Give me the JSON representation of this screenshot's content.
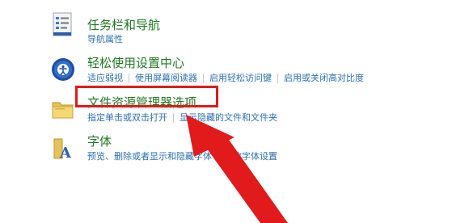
{
  "items": [
    {
      "icon": "taskbar-nav-icon",
      "title": "任务栏和导航",
      "links": [
        "导航属性"
      ]
    },
    {
      "icon": "ease-of-access-icon",
      "title": "轻松使用设置中心",
      "links": [
        "适应弱视",
        "使用屏幕阅读器",
        "启用轻松访问键",
        "启用或关闭高对比度"
      ]
    },
    {
      "icon": "folder-options-icon",
      "title": "文件资源管理器选项",
      "links": [
        "指定单击或双击打开",
        "显示隐藏的文件和文件夹"
      ]
    },
    {
      "icon": "fonts-icon",
      "title": "字体",
      "links": [
        "预览、删除或者显示和隐藏字体",
        "更改字体设置"
      ]
    }
  ],
  "colors": {
    "title": "#1e7a20",
    "link": "#2a6fb5",
    "annotation": "#e11b1b"
  }
}
